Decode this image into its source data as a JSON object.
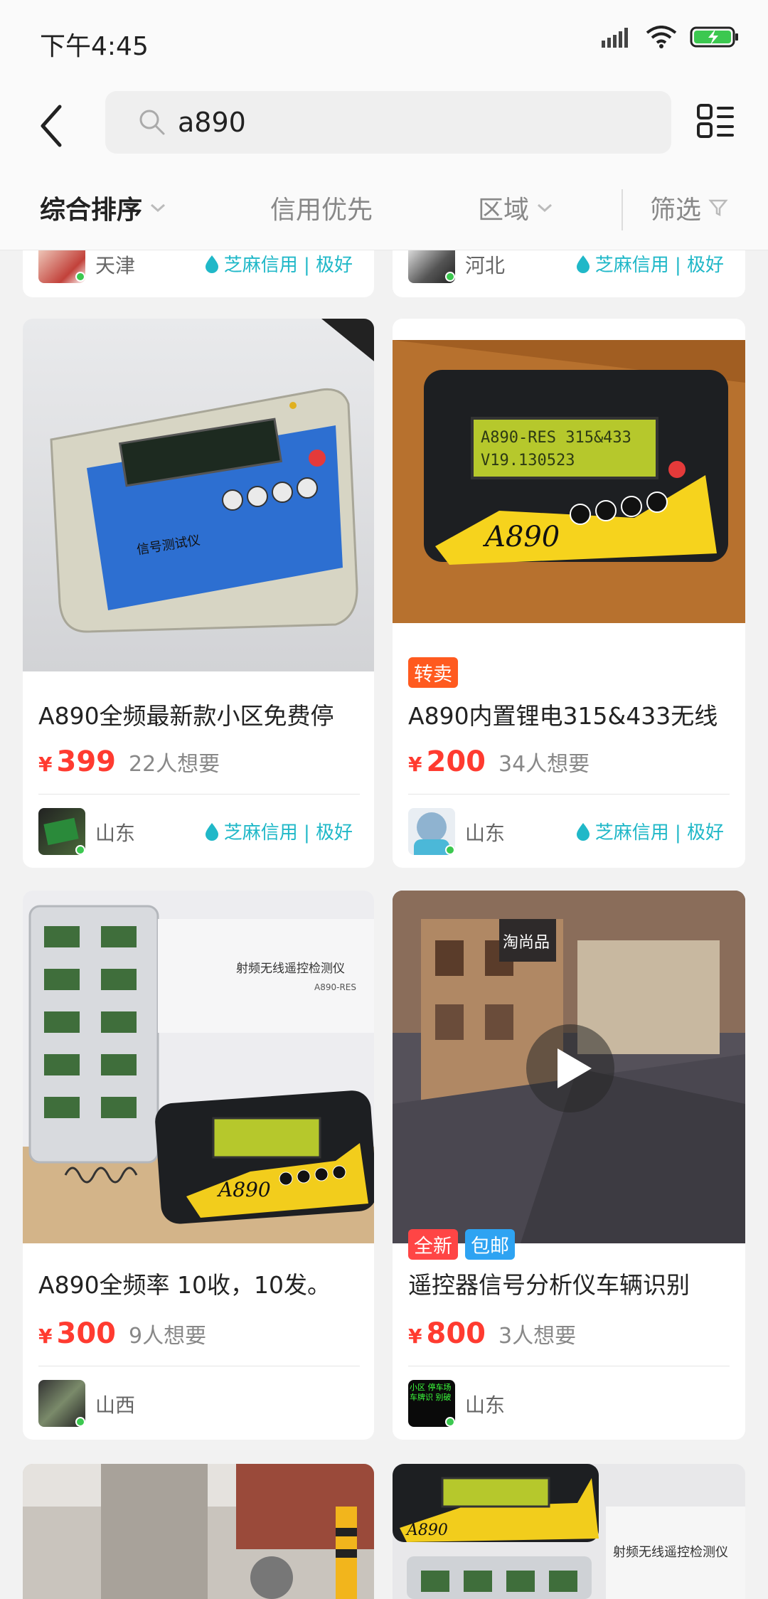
{
  "status": {
    "time": "下午4:45"
  },
  "search": {
    "query": "a890"
  },
  "filters": {
    "tabs": [
      {
        "label": "综合排序"
      },
      {
        "label": "信用优先"
      },
      {
        "label": "区域"
      },
      {
        "label": "筛选"
      }
    ]
  },
  "top_partial": [
    {
      "location": "天津",
      "credit": "芝麻信用 | 极好"
    },
    {
      "location": "河北",
      "credit": "芝麻信用 | 极好"
    }
  ],
  "products": [
    {
      "title": "A890全频最新款小区免费停",
      "currency": "¥",
      "price": "399",
      "want": "22人想要",
      "location": "山东",
      "credit": "芝麻信用 | 极好",
      "badges": []
    },
    {
      "title": "A890内置锂电315&433无线",
      "currency": "¥",
      "price": "200",
      "want": "34人想要",
      "location": "山东",
      "credit": "芝麻信用 | 极好",
      "badges": [
        "转卖"
      ]
    },
    {
      "title": "A890全频率 10收，10发。",
      "currency": "¥",
      "price": "300",
      "want": "9人想要",
      "location": "山西",
      "credit": "",
      "badges": []
    },
    {
      "title": "遥控器信号分析仪车辆识别",
      "currency": "¥",
      "price": "800",
      "want": "3人想要",
      "location": "山东",
      "credit": "",
      "badges": [
        "全新",
        "包邮"
      ]
    }
  ],
  "image_text": {
    "device_label_1": "信号测试仪",
    "device_brand": "A890",
    "lcd_line1": "A890-RES 315&433",
    "lcd_line2": "V19.130523",
    "doc_title": "射频无线遥控检测仪",
    "doc_sub": "A890-RES",
    "shop_sign": "淘尚品",
    "avatar_text": "小区 停车场 车牌识 别破"
  },
  "colors": {
    "price": "#ff3b30",
    "credit": "#20b8c8",
    "badge_resale": "#ff5a1f",
    "badge_new": "#ff4545",
    "badge_ship": "#2ea3f2"
  }
}
